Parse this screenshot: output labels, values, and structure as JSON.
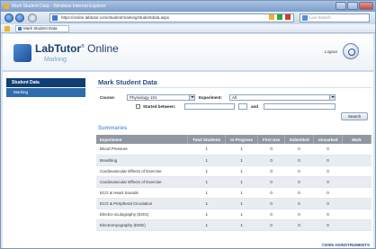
{
  "window": {
    "title": "Mark Student Data - Windows Internet Explorer",
    "address": "https://online.labtutor.com/student/marking/studentdata.aspx",
    "search_placeholder": "Live Search",
    "tab_label": "Mark Student Data"
  },
  "app": {
    "brand_name": "LabTutor",
    "brand_mark": "®",
    "brand_suffix": "Online",
    "subtitle": "Marking",
    "logout_label": "Logout"
  },
  "sidebar": {
    "heading": "Student Data",
    "items": [
      {
        "label": "Marking"
      }
    ]
  },
  "main": {
    "title": "Mark Student Data",
    "course_label": "Course:",
    "course_value": "Physiology 101",
    "experiment_label": "Experiment:",
    "experiment_value": "All",
    "started_between_label": "Started between:",
    "and_label": "and",
    "search_label": "Search",
    "summaries_title": "Summaries"
  },
  "table": {
    "headers": [
      "Experiment",
      "Total Students",
      "In Progress",
      "First Use",
      "Submitted",
      "Unmarked",
      "Mark"
    ],
    "rows": [
      [
        "Blood Pressure",
        "1",
        "1",
        "0",
        "0",
        "0",
        ""
      ],
      [
        "Breathing",
        "1",
        "1",
        "0",
        "0",
        "0",
        ""
      ],
      [
        "Cardiovascular Effects of Exercise",
        "1",
        "1",
        "0",
        "0",
        "0",
        ""
      ],
      [
        "Cardiovascular Effects of Exercise",
        "1",
        "1",
        "0",
        "0",
        "0",
        ""
      ],
      [
        "ECG & Heart Sounds",
        "1",
        "1",
        "0",
        "0",
        "0",
        ""
      ],
      [
        "ECG & Peripheral Circulation",
        "1",
        "1",
        "0",
        "0",
        "0",
        ""
      ],
      [
        "Electro-oculography (EOG)",
        "1",
        "1",
        "0",
        "0",
        "0",
        ""
      ],
      [
        "Electromyography (EMG)",
        "1",
        "1",
        "0",
        "0",
        "0",
        ""
      ]
    ]
  },
  "footer": {
    "brand": "©2009 ADINSTRUMENTS"
  },
  "colors": {
    "header_dark": "#0f3f74",
    "nav_item": "#2f6cad",
    "title_blue": "#2a4f86",
    "accent_light": "#6a9fd6",
    "table_header": "#8f97a1"
  }
}
